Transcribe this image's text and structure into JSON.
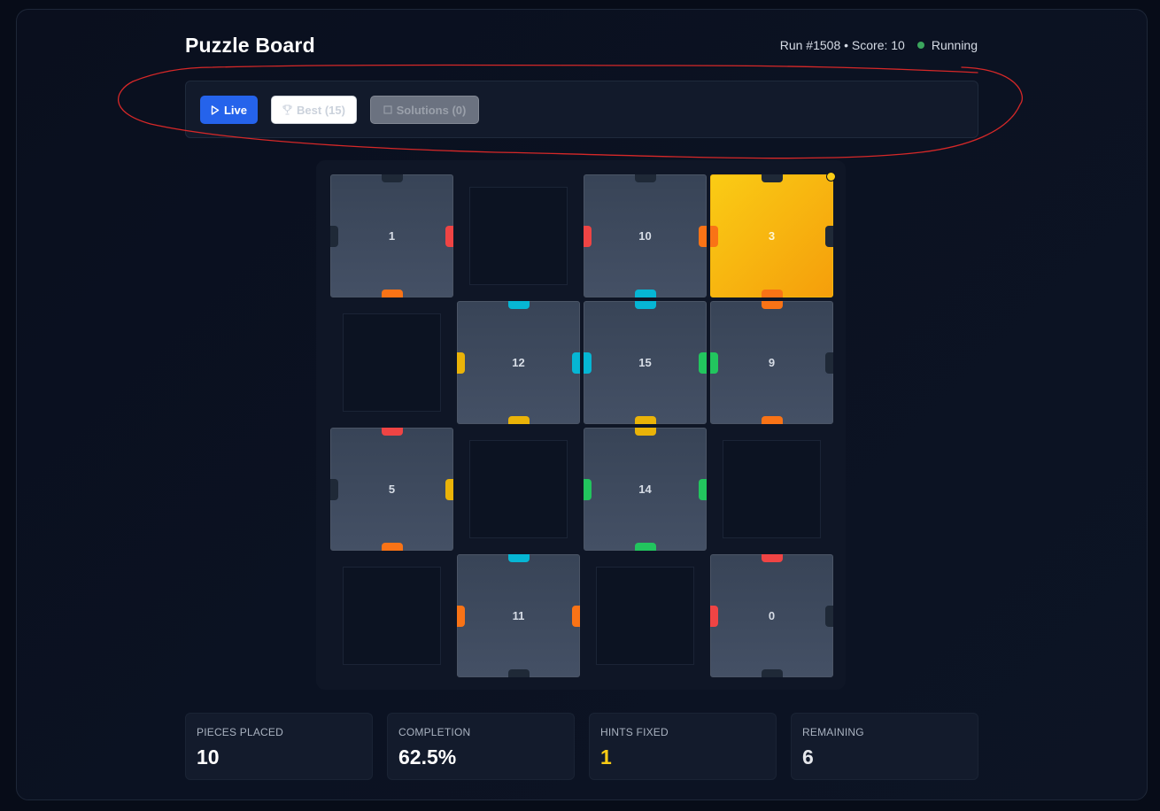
{
  "header": {
    "title": "Puzzle Board",
    "run_info": "Run #1508 • Score: 10",
    "status": "Running",
    "status_color": "#3ba55d"
  },
  "toolbar": {
    "live_label": "Live",
    "live_icon": "play-icon",
    "best_label": "Best (15)",
    "best_icon": "trophy-icon",
    "solutions_label": "Solutions (0)",
    "solutions_icon": "square-icon"
  },
  "edge_colors": {
    "dark": "#1f2937",
    "red": "#ef4444",
    "orange": "#f97316",
    "cyan": "#06b6d4",
    "yellow": "#eab308",
    "green": "#22c55e"
  },
  "board": {
    "rows": 4,
    "cols": 4,
    "cells": [
      {
        "row": 0,
        "col": 0,
        "piece": "1",
        "edges": {
          "top": "dark",
          "right": "red",
          "bottom": "orange",
          "left": "dark"
        }
      },
      {
        "row": 0,
        "col": 1,
        "piece": null
      },
      {
        "row": 0,
        "col": 2,
        "piece": "10",
        "edges": {
          "top": "dark",
          "right": "orange",
          "bottom": "cyan",
          "left": "red"
        }
      },
      {
        "row": 0,
        "col": 3,
        "piece": "3",
        "highlighted": true,
        "hint_fixed": true,
        "edges": {
          "top": "dark",
          "right": "dark",
          "bottom": "orange",
          "left": "orange"
        }
      },
      {
        "row": 1,
        "col": 0,
        "piece": null
      },
      {
        "row": 1,
        "col": 1,
        "piece": "12",
        "edges": {
          "top": "cyan",
          "right": "cyan",
          "bottom": "yellow",
          "left": "yellow"
        }
      },
      {
        "row": 1,
        "col": 2,
        "piece": "15",
        "edges": {
          "top": "cyan",
          "right": "green",
          "bottom": "yellow",
          "left": "cyan"
        }
      },
      {
        "row": 1,
        "col": 3,
        "piece": "9",
        "edges": {
          "top": "orange",
          "right": "dark",
          "bottom": "orange",
          "left": "green"
        }
      },
      {
        "row": 2,
        "col": 0,
        "piece": "5",
        "edges": {
          "top": "red",
          "right": "yellow",
          "bottom": "orange",
          "left": "dark"
        }
      },
      {
        "row": 2,
        "col": 1,
        "piece": null
      },
      {
        "row": 2,
        "col": 2,
        "piece": "14",
        "edges": {
          "top": "yellow",
          "right": "green",
          "bottom": "green",
          "left": "green"
        }
      },
      {
        "row": 2,
        "col": 3,
        "piece": null
      },
      {
        "row": 3,
        "col": 0,
        "piece": null
      },
      {
        "row": 3,
        "col": 1,
        "piece": "11",
        "edges": {
          "top": "cyan",
          "right": "orange",
          "bottom": "dark",
          "left": "orange"
        }
      },
      {
        "row": 3,
        "col": 2,
        "piece": null
      },
      {
        "row": 3,
        "col": 3,
        "piece": "0",
        "edges": {
          "top": "red",
          "right": "dark",
          "bottom": "dark",
          "left": "red"
        }
      }
    ]
  },
  "stats": [
    {
      "label": "Pieces Placed",
      "value": "10",
      "color": "#ffffff"
    },
    {
      "label": "Completion",
      "value": "62.5%",
      "color": "#ffffff"
    },
    {
      "label": "Hints Fixed",
      "value": "1",
      "color": "#facc15"
    },
    {
      "label": "Remaining",
      "value": "6",
      "color": "#e5e7eb"
    }
  ],
  "annotation_color": "#d62828"
}
